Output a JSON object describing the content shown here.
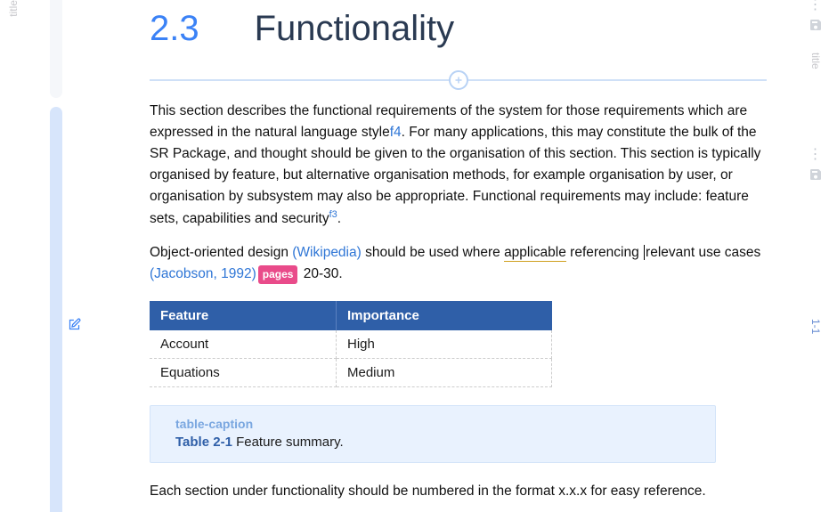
{
  "gutter": {
    "left_label": "title",
    "right_label_top": "title",
    "right_label_mid": "1-1"
  },
  "heading": {
    "number": "2.3",
    "title": "Functionality"
  },
  "paragraphs": {
    "intro_a": "This section describes the functional requirements of the system for those requirements which are expressed in the natural language style",
    "foot4": "f4",
    "intro_b": ". For many applications, this may constitute the bulk of the SR Package, and thought should be given to the organisation of this section. This section is typically organised by feature, but alternative organisation methods, for example organisation by user, or organisation by subsystem may also be appropriate. Functional requirements may include: feature sets, capabilities and security",
    "foot3": "f3",
    "p2_a": "Object-oriented design ",
    "p2_link1": "(Wikipedia)",
    "p2_b": " should be used where ",
    "p2_applicable": "applicable",
    "p2_c": " referencing ",
    "p2_d": "relevant use cases ",
    "p2_link2": "(Jacobson, 1992)",
    "p2_pages_tag": "pages",
    "p2_pages_val": " 20-30.",
    "trail": "Each section under functionality should be numbered in the format x.x.x for easy reference."
  },
  "table": {
    "col1": "Feature",
    "col2": "Importance",
    "rows": [
      {
        "feature": "Account",
        "importance": "High"
      },
      {
        "feature": "Equations",
        "importance": "Medium"
      }
    ]
  },
  "caption": {
    "label": "table-caption",
    "id": "Table 2-1",
    "text": " Feature summary."
  }
}
